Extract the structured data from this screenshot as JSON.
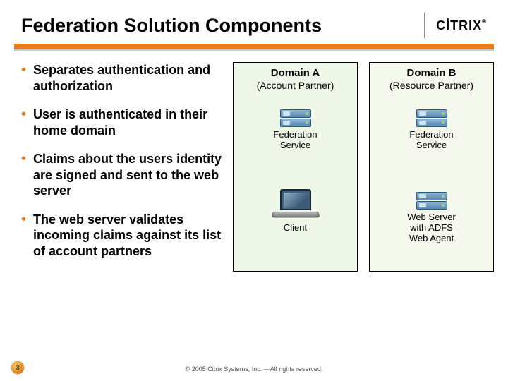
{
  "title": "Federation Solution Components",
  "logo_text": "CİTRIX",
  "bullets": [
    "Separates authentication and authorization",
    "User is authenticated in their home domain",
    "Claims about the users identity are signed and sent to the web server",
    "The web server validates incoming claims against its list of account partners"
  ],
  "domainA": {
    "title": "Domain A",
    "subtitle": "(Account Partner)",
    "comp1": "Federation\nService",
    "comp2": "Client"
  },
  "domainB": {
    "title": "Domain B",
    "subtitle": "(Resource Partner)",
    "comp1": "Federation\nService",
    "comp2": "Web Server\nwith ADFS\nWeb Agent"
  },
  "footer": "© 2005 Citrix Systems, Inc. —All rights reserved.",
  "page": "3"
}
